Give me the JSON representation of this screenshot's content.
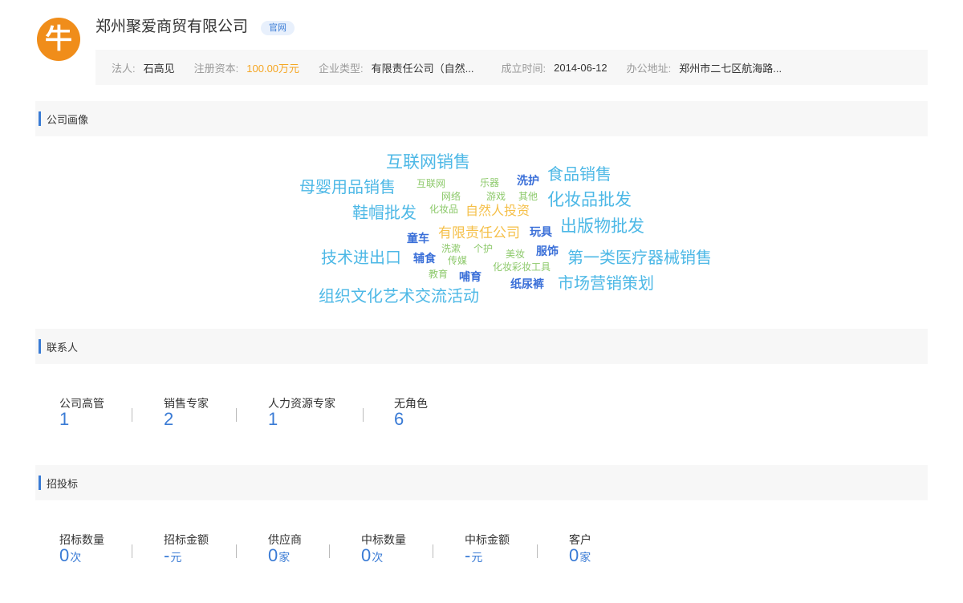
{
  "company": {
    "logo_char": "牛",
    "name": "郑州聚爱商贸有限公司",
    "official_tag": "官网"
  },
  "info_bar": [
    {
      "label": "法人:",
      "value": "石高见"
    },
    {
      "label": "注册资本:",
      "value": "100.00万元"
    },
    {
      "label": "企业类型:",
      "value": "有限责任公司（自然..."
    },
    {
      "label": "成立时间:",
      "value": "2014-06-12"
    },
    {
      "label": "办公地址:",
      "value": "郑州市二七区航海路..."
    }
  ],
  "sections": {
    "portrait": "公司画像",
    "contacts": "联系人",
    "bidding": "招投标"
  },
  "word_cloud": {
    "words": [
      {
        "text": "互联网销售",
        "color": "#4db8e6"
      },
      {
        "text": "母婴用品销售",
        "color": "#4db8e6"
      },
      {
        "text": "互联网",
        "color": "#8dc96b"
      },
      {
        "text": "乐器",
        "color": "#8dc96b"
      },
      {
        "text": "洗护",
        "color": "#3a6fd8"
      },
      {
        "text": "食品销售",
        "color": "#4db8e6"
      },
      {
        "text": "网络",
        "color": "#8dc96b"
      },
      {
        "text": "游戏",
        "color": "#8dc96b"
      },
      {
        "text": "其他",
        "color": "#8dc96b"
      },
      {
        "text": "化妆品批发",
        "color": "#4db8e6"
      },
      {
        "text": "鞋帽批发",
        "color": "#4db8e6"
      },
      {
        "text": "化妆品",
        "color": "#8dc96b"
      },
      {
        "text": "自然人投资",
        "color": "#f5c04a"
      },
      {
        "text": "童车",
        "color": "#3a6fd8"
      },
      {
        "text": "有限责任公司",
        "color": "#f5c04a"
      },
      {
        "text": "玩具",
        "color": "#3a6fd8"
      },
      {
        "text": "出版物批发",
        "color": "#4db8e6"
      },
      {
        "text": "洗漱",
        "color": "#8dc96b"
      },
      {
        "text": "个护",
        "color": "#8dc96b"
      },
      {
        "text": "技术进出口",
        "color": "#4db8e6"
      },
      {
        "text": "辅食",
        "color": "#3a6fd8"
      },
      {
        "text": "传媒",
        "color": "#8dc96b"
      },
      {
        "text": "美妆",
        "color": "#8dc96b"
      },
      {
        "text": "服饰",
        "color": "#3a6fd8"
      },
      {
        "text": "第一类医疗器械销售",
        "color": "#4db8e6"
      },
      {
        "text": "化妆彩妆工具",
        "color": "#8dc96b"
      },
      {
        "text": "教育",
        "color": "#8dc96b"
      },
      {
        "text": "哺育",
        "color": "#3a6fd8"
      },
      {
        "text": "纸尿裤",
        "color": "#3a6fd8"
      },
      {
        "text": "市场营销策划",
        "color": "#4db8e6"
      },
      {
        "text": "组织文化艺术交流活动",
        "color": "#4db8e6"
      }
    ]
  },
  "contacts": [
    {
      "label": "公司高管",
      "value": "1"
    },
    {
      "label": "销售专家",
      "value": "2"
    },
    {
      "label": "人力资源专家",
      "value": "1"
    },
    {
      "label": "无角色",
      "value": "6"
    }
  ],
  "bidding": [
    {
      "label": "招标数量",
      "value": "0",
      "unit": "次"
    },
    {
      "label": "招标金额",
      "value": "-",
      "unit": "元"
    },
    {
      "label": "供应商",
      "value": "0",
      "unit": "家"
    },
    {
      "label": "中标数量",
      "value": "0",
      "unit": "次"
    },
    {
      "label": "中标金额",
      "value": "-",
      "unit": "元"
    },
    {
      "label": "客户",
      "value": "0",
      "unit": "家"
    }
  ]
}
